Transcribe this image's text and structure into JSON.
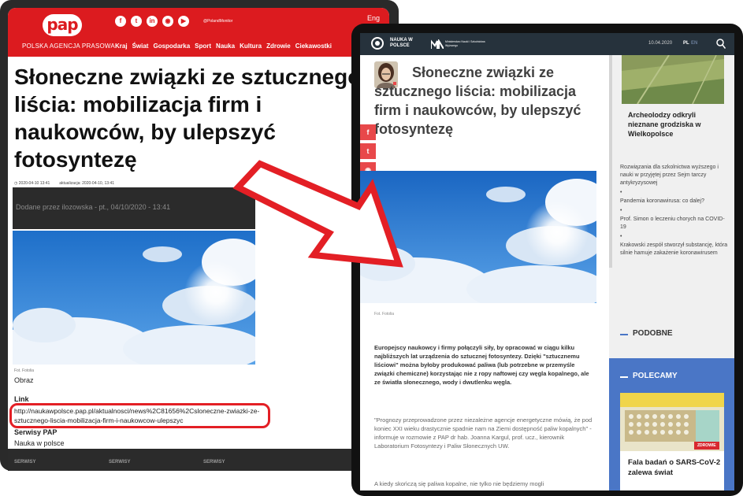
{
  "colors": {
    "pap_red": "#dc1b1f",
    "nwp_navy": "#26323c",
    "polecamy_blue": "#4a76c6",
    "highlight_red": "#e31f25"
  },
  "pap": {
    "logo": "pap",
    "tagline": "POLSKA AGENCJA PRASOWA",
    "social_icons": [
      "facebook-icon",
      "twitter-icon",
      "linkedin-icon",
      "rss-icon",
      "youtube-icon"
    ],
    "social_labels": [
      "f",
      "t",
      "in",
      "◉",
      "▶"
    ],
    "social_handle": "@PolandMonitor",
    "lang": "Eng",
    "nav": [
      "Kraj",
      "Świat",
      "Gospodarka",
      "Sport",
      "Nauka",
      "Kultura",
      "Zdrowie",
      "Ciekawostki"
    ],
    "title": "Słoneczne związki ze sztucznego liścia: mobilizacja firm i naukowców, by ulepszyć fotosyntezę",
    "date_published": "◷ 2020-04-10 13:41",
    "date_updated": "aktualizacja: 2020-04-10, 13:41",
    "added_by": "Dodane przez ilozowska - pt., 04/10/2020 - 13:41",
    "image_credit": "Fot. Fotolia",
    "obraz": "Obraz",
    "link_label": "Link",
    "link_url": "http://naukawpolsce.pap.pl/aktualnosci/news%2C81656%2Csloneczne-zwiazki-ze-sztucznego-liscia-mobilizacja-firm-i-naukowcow-ulepszyc",
    "services_label": "Serwisy PAP",
    "services_value": "Nauka w polsce",
    "footer": [
      "SERWISY",
      "SERWISY",
      "SERWISY"
    ]
  },
  "nwp": {
    "brand": "NAUKA W POLSCE",
    "ministry": "Ministerstwo Nauki i Szkolnictwa Wyższego",
    "date": "10.04.2020",
    "lang_active": "PL",
    "lang_other": "EN",
    "title": "Słoneczne związki ze sztucznego liścia: mobilizacja firm i naukowców, by ulepszyć fotosyntezę",
    "share_icons": [
      "facebook-icon",
      "twitter-icon",
      "rss-icon",
      "email-icon"
    ],
    "share_labels": [
      "f",
      "t",
      "◉",
      "✉"
    ],
    "image_credit": "Fot. Fotolia",
    "lead": "Europejscy naukowcy i firmy połączyli siły, by opracować w ciągu kilku najbliższych lat urządzenia do sztucznej fotosyntezy. Dzięki \"sztucznemu liściowi\" można byłoby produkować paliwa (lub potrzebne w przemyśle związki chemiczne) korzystając nie z ropy naftowej czy węgla kopalnego, ale ze światła słonecznego, wody i dwutlenku węgla.",
    "quote": "\"Prognozy przeprowadzone przez niezależne agencje energetyczne mówią, że pod koniec XXI wieku drastycznie spadnie nam na Ziemi dostępność paliw kopalnych\" - informuje w rozmowie z PAP dr hab. Joanna Kargul, prof. ucz., kierownik Laboratorium Fotosyntezy i Paliw Słonecznych UW.",
    "more": "A kiedy skończą się paliwa kopalne, nie tylko nie będziemy mogli",
    "sidebar": {
      "teaser_title": "Archeolodzy odkryli nieznane grodziska w Wielkopolsce",
      "list": [
        "Rozwiązania dla szkolnictwa wyższego i nauki w przyjętej przez Sejm tarczy antykryzysowej",
        "Pandemia koronawirusa: co dalej?",
        "Prof. Simon o leczeniu chorych na COVID-19",
        "Krakowski zespół stworzył substancję, która silnie hamuje zakażenie koronawirusem"
      ],
      "bullet": "•",
      "podobne": "PODOBNE",
      "polecamy": "POLECAMY",
      "card_badge": "ZDROWIE",
      "card_title": "Fala badań o SARS-CoV-2 zalewa świat"
    }
  }
}
